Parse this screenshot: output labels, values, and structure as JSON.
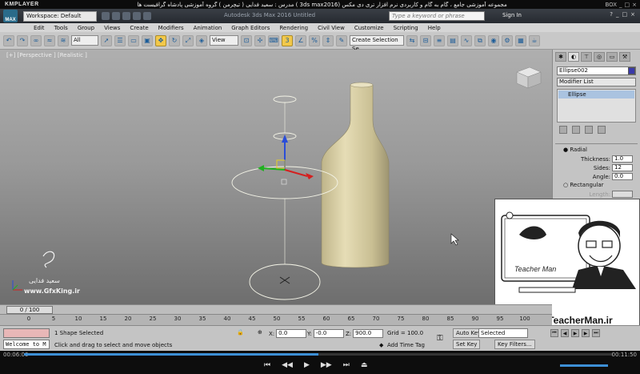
{
  "player": {
    "logo": "KMPLAYER",
    "title": "مجموعه آموزشی جامع ، گام به گام و کاربردی نرم افزار تری دی مکس (3ds max2016 )  مدرس : سعید فدایی ( تیچرمن ) گروه آموزشی پادشاه گرافیست ها",
    "window_buttons": [
      "BOX",
      "_",
      "□",
      "×"
    ],
    "time_elapsed": "00:06:00",
    "time_total": "00:11:50",
    "progress": 0.5,
    "controls": [
      "⏮",
      "◀◀",
      "▶",
      "▶▶",
      "⏭",
      "⏏"
    ]
  },
  "app": {
    "workspace_label": "Workspace: Default",
    "title": "Autodesk 3ds Max 2016    Untitled",
    "search_placeholder": "Type a keyword or phrase",
    "sign_in": "Sign In",
    "logo_text": "MAX"
  },
  "menu": [
    "Edit",
    "Tools",
    "Group",
    "Views",
    "Create",
    "Modifiers",
    "Animation",
    "Graph Editors",
    "Rendering",
    "Civil View",
    "Customize",
    "Scripting",
    "Help"
  ],
  "toolbar": {
    "filter_value": "All",
    "refcoord_value": "View",
    "selection_set_placeholder": "Create Selection Se"
  },
  "viewport": {
    "label": "[+] [Perspective ] [Realistic ]",
    "watermark_name": "سعید فدایی",
    "watermark_site": "www.GfxKing.ir"
  },
  "command_panel": {
    "object_name": "Ellipse002",
    "modifier_list": "Modifier List",
    "stack_item": "Ellipse",
    "radial_label": "Radial",
    "params": [
      {
        "label": "Thickness:",
        "value": "1.0"
      },
      {
        "label": "Sides:",
        "value": "12"
      },
      {
        "label": "Angle:",
        "value": "0.0"
      }
    ],
    "rectangular_label": "Rectangular",
    "length_label": "Length:",
    "object_color": "#3a3aaa"
  },
  "promo": {
    "brand": "Teacher Man",
    "website": "www.TeacherMan.ir"
  },
  "timeline": {
    "frame_indicator": "0 / 100",
    "ticks": [
      "0",
      "5",
      "10",
      "15",
      "20",
      "25",
      "30",
      "35",
      "40",
      "45",
      "50",
      "55",
      "60",
      "65",
      "70",
      "75",
      "80",
      "85",
      "90",
      "95",
      "100"
    ]
  },
  "status": {
    "maxscript_text": "Welcome to M",
    "selected_count": "1 Shape Selected",
    "prompt": "Click and drag to select and move objects",
    "x_label": "X:",
    "x_value": "0.0",
    "y_label": "Y:",
    "y_value": "-0.0",
    "z_label": "Z:",
    "z_value": "900.0",
    "grid": "Grid = 100.0",
    "add_time_tag": "Add Time Tag",
    "auto_key": "Auto Key",
    "set_key": "Set Key",
    "selected_dropdown": "Selected",
    "key_filters": "Key Filters..."
  }
}
